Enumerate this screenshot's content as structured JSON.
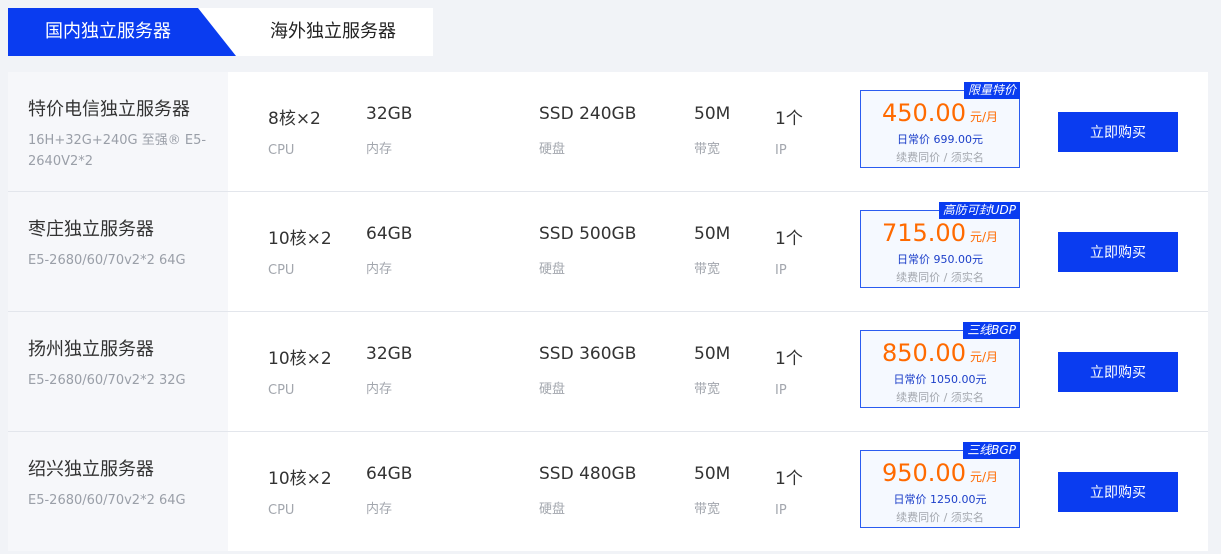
{
  "tabs": {
    "active": "国内独立服务器",
    "inactive": "海外独立服务器"
  },
  "rows": [
    {
      "title": "特价电信独立服务器",
      "desc": "16H+32G+240G 至强® E5-2640V2*2",
      "cpu": {
        "value": "8核×2",
        "label": "CPU"
      },
      "mem": {
        "value": "32GB",
        "label": "内存"
      },
      "disk": {
        "value": "SSD 240GB",
        "label": "硬盘"
      },
      "bw": {
        "value": "50M",
        "label": "带宽"
      },
      "ip": {
        "value": "1个",
        "label": "IP"
      },
      "badge": "限量特价",
      "price": "450.00",
      "unit": "元/月",
      "orig": "日常价 699.00元",
      "renew": "续费同价 / 须实名",
      "buy": "立即购买"
    },
    {
      "title": "枣庄独立服务器",
      "desc": "E5-2680/60/70v2*2 64G",
      "cpu": {
        "value": "10核×2",
        "label": "CPU"
      },
      "mem": {
        "value": "64GB",
        "label": "内存"
      },
      "disk": {
        "value": "SSD 500GB",
        "label": "硬盘"
      },
      "bw": {
        "value": "50M",
        "label": "带宽"
      },
      "ip": {
        "value": "1个",
        "label": "IP"
      },
      "badge": "高防可封UDP",
      "price": "715.00",
      "unit": "元/月",
      "orig": "日常价 950.00元",
      "renew": "续费同价 / 须实名",
      "buy": "立即购买"
    },
    {
      "title": "扬州独立服务器",
      "desc": "E5-2680/60/70v2*2 32G",
      "cpu": {
        "value": "10核×2",
        "label": "CPU"
      },
      "mem": {
        "value": "32GB",
        "label": "内存"
      },
      "disk": {
        "value": "SSD 360GB",
        "label": "硬盘"
      },
      "bw": {
        "value": "50M",
        "label": "带宽"
      },
      "ip": {
        "value": "1个",
        "label": "IP"
      },
      "badge": "三线BGP",
      "price": "850.00",
      "unit": "元/月",
      "orig": "日常价 1050.00元",
      "renew": "续费同价 / 须实名",
      "buy": "立即购买"
    },
    {
      "title": "绍兴独立服务器",
      "desc": "E5-2680/60/70v2*2 64G",
      "cpu": {
        "value": "10核×2",
        "label": "CPU"
      },
      "mem": {
        "value": "64GB",
        "label": "内存"
      },
      "disk": {
        "value": "SSD 480GB",
        "label": "硬盘"
      },
      "bw": {
        "value": "50M",
        "label": "带宽"
      },
      "ip": {
        "value": "1个",
        "label": "IP"
      },
      "badge": "三线BGP",
      "price": "950.00",
      "unit": "元/月",
      "orig": "日常价 1250.00元",
      "renew": "续费同价 / 须实名",
      "buy": "立即购买"
    }
  ]
}
